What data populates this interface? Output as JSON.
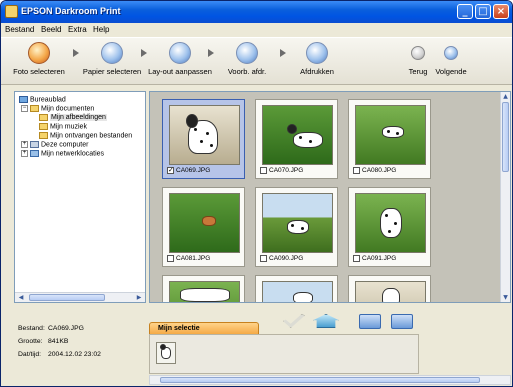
{
  "window": {
    "title": "EPSON Darkroom Print"
  },
  "menu": [
    "Bestand",
    "Beeld",
    "Extra",
    "Help"
  ],
  "toolbar": {
    "tools": [
      {
        "label": "Foto selecteren",
        "icon": "photo-select-icon"
      },
      {
        "label": "Papier selecteren",
        "icon": "paper-select-icon"
      },
      {
        "label": "Lay-out aanpassen",
        "icon": "layout-icon"
      },
      {
        "label": "Voorb. afdr.",
        "icon": "preview-icon"
      },
      {
        "label": "Afdrukken",
        "icon": "print-icon"
      }
    ],
    "back_label": "Terug",
    "next_label": "Volgende"
  },
  "tree": [
    {
      "label": "Bureaublad",
      "icon": "desktop-icon"
    },
    {
      "label": "Mijn documenten",
      "icon": "folder-icon",
      "expander": "−"
    },
    {
      "label": "Mijn afbeeldingen",
      "icon": "folder-icon",
      "selected": true
    },
    {
      "label": "Mijn muziek",
      "icon": "folder-icon"
    },
    {
      "label": "Mijn ontvangen bestanden",
      "icon": "folder-icon"
    },
    {
      "label": "Deze computer",
      "icon": "computer-icon",
      "expander": "+"
    },
    {
      "label": "Mijn netwerklocaties",
      "icon": "network-icon",
      "expander": "+"
    }
  ],
  "thumbnails": [
    {
      "name": "CA069.JPG",
      "checked": true,
      "selected": true
    },
    {
      "name": "CA070.JPG",
      "checked": false
    },
    {
      "name": "CA080.JPG",
      "checked": false
    },
    {
      "name": "CA081.JPG",
      "checked": false
    },
    {
      "name": "CA090.JPG",
      "checked": false
    },
    {
      "name": "CA091.JPG",
      "checked": false
    },
    {
      "name": "",
      "checked": false
    },
    {
      "name": "",
      "checked": false
    },
    {
      "name": "",
      "checked": false
    }
  ],
  "info": {
    "file_label": "Bestand:",
    "file_value": "CA069.JPG",
    "size_label": "Grootte:",
    "size_value": "841KB",
    "date_label": "Dat/tijd:",
    "date_value": "2004.12.02 23:02"
  },
  "selection": {
    "tab_label": "Mijn selectie"
  }
}
